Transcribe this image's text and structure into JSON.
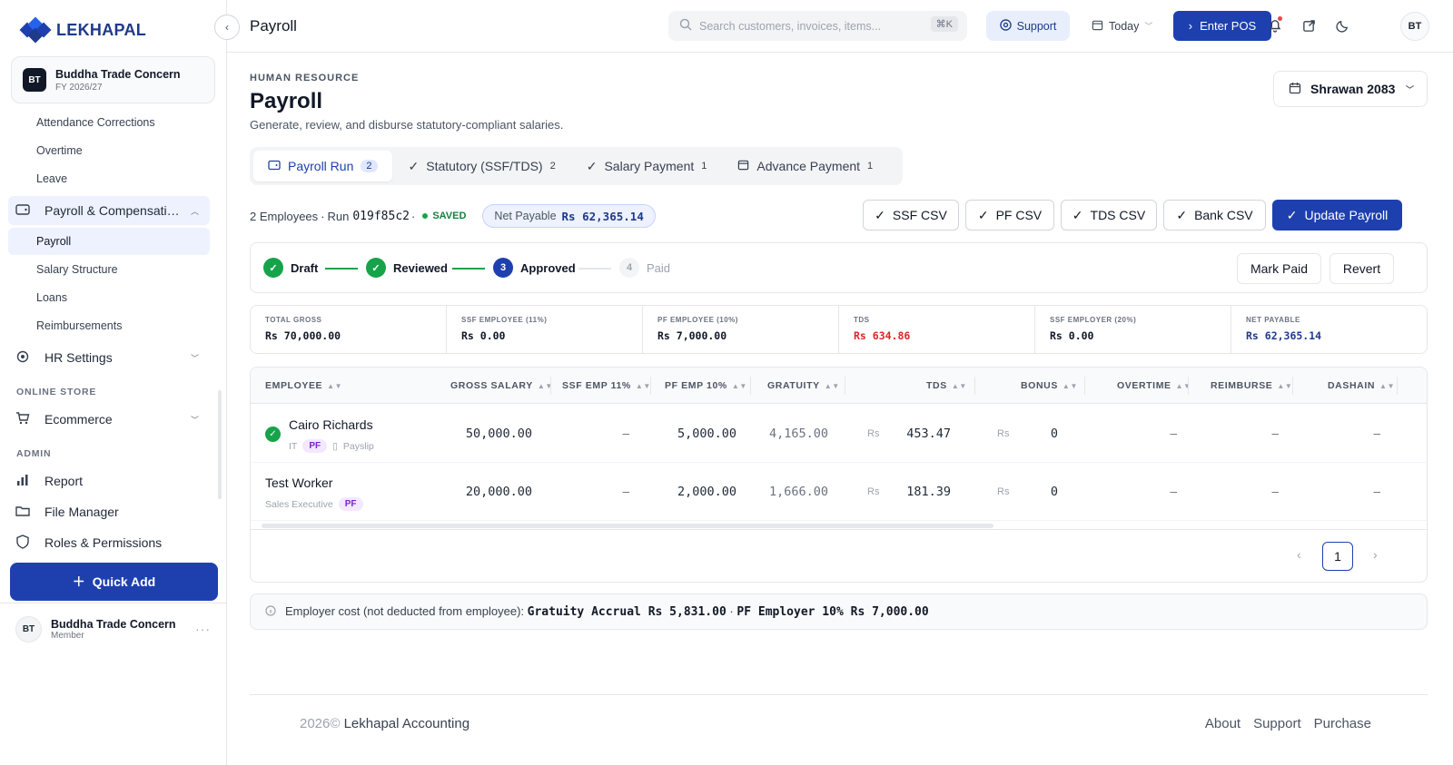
{
  "colors": {
    "primary": "#1e40af",
    "success": "#16a34a",
    "danger": "#dc2626",
    "pf_badge": "#7e22ce"
  },
  "brand": {
    "name": "LEKHAPAL"
  },
  "org": {
    "initials": "BT",
    "name": "Buddha Trade Concern",
    "fy": "FY 2026/27"
  },
  "sidebar": {
    "items": [
      {
        "label": "Attendance Corrections"
      },
      {
        "label": "Overtime"
      },
      {
        "label": "Leave"
      }
    ],
    "payroll_group": {
      "label": "Payroll & Compensati…",
      "icon": "wallet-icon"
    },
    "payroll_items": [
      {
        "label": "Payroll"
      },
      {
        "label": "Salary Structure"
      },
      {
        "label": "Loans"
      },
      {
        "label": "Reimbursements"
      }
    ],
    "hr_settings": {
      "label": "HR Settings",
      "icon": "settings-icon"
    },
    "online_store_section": "ONLINE STORE",
    "ecommerce": {
      "label": "Ecommerce",
      "icon": "cart-icon"
    },
    "admin_section": "ADMIN",
    "report": {
      "label": "Report",
      "icon": "report-icon"
    },
    "file_manager": {
      "label": "File Manager",
      "icon": "folder-icon"
    },
    "roles": {
      "label": "Roles & Permissions",
      "icon": "shield-icon"
    },
    "quick_add": "Quick Add",
    "user": {
      "initials": "BT",
      "name": "Buddha Trade Concern",
      "role": "Member"
    }
  },
  "topbar": {
    "title": "Payroll",
    "search_placeholder": "Search customers, invoices, items...",
    "search_shortcut": "⌘K",
    "support": "Support",
    "date": "Today",
    "pos": "Enter POS",
    "avatar": "BT"
  },
  "page": {
    "eyebrow": "HUMAN RESOURCE",
    "title": "Payroll",
    "description": "Generate, review, and disburse statutory-compliant salaries.",
    "period": "Shrawan 2083"
  },
  "tabs": [
    {
      "label": "Payroll Run",
      "count": "2"
    },
    {
      "label": "Statutory (SSF/TDS)",
      "count": "2"
    },
    {
      "label": "Salary Payment",
      "count": "1"
    },
    {
      "label": "Advance Payment",
      "count": "1"
    }
  ],
  "run": {
    "employees": "2 Employees",
    "sep": "·",
    "run_label": "Run",
    "run_id": "019f85c2",
    "status": "SAVED",
    "net_label": "Net Payable",
    "net_value": "Rs 62,365.14"
  },
  "actions": {
    "ssf": "SSF CSV",
    "pf": "PF CSV",
    "tds": "TDS CSV",
    "bank": "Bank CSV",
    "update": "Update Payroll"
  },
  "steps": [
    {
      "label": "Draft",
      "state": "done"
    },
    {
      "label": "Reviewed",
      "state": "done"
    },
    {
      "label": "Approved",
      "number": "3",
      "state": "current"
    },
    {
      "label": "Paid",
      "number": "4",
      "state": "pending"
    }
  ],
  "step_actions": {
    "mark_paid": "Mark Paid",
    "revert": "Revert"
  },
  "stats": [
    {
      "label": "TOTAL GROSS",
      "value": "Rs 70,000.00"
    },
    {
      "label": "SSF EMPLOYEE (11%)",
      "value": "Rs 0.00"
    },
    {
      "label": "PF EMPLOYEE (10%)",
      "value": "Rs 7,000.00"
    },
    {
      "label": "TDS",
      "value": "Rs 634.86"
    },
    {
      "label": "SSF EMPLOYER (20%)",
      "value": "Rs 0.00"
    },
    {
      "label": "NET PAYABLE",
      "value": "Rs 62,365.14"
    }
  ],
  "table": {
    "columns": [
      "EMPLOYEE",
      "GROSS SALARY",
      "SSF EMP 11%",
      "PF EMP 10%",
      "GRATUITY",
      "TDS",
      "BONUS",
      "OVERTIME",
      "REIMBURSE",
      "DASHAIN"
    ],
    "rows": [
      {
        "name": "Cairo Richards",
        "dept": "IT",
        "badge": "PF",
        "payslip": "Payslip",
        "gross": "50,000.00",
        "ssf": "–",
        "pf": "5,000.00",
        "gratuity": "4,165.00",
        "tds_cur": "Rs",
        "tds": "453.47",
        "bonus_cur": "Rs",
        "bonus": "0",
        "overtime": "–",
        "reimburse": "–",
        "dashain": "–"
      },
      {
        "name": "Test Worker",
        "dept": "Sales Executive",
        "badge": "PF",
        "gross": "20,000.00",
        "ssf": "–",
        "pf": "2,000.00",
        "gratuity": "1,666.00",
        "tds_cur": "Rs",
        "tds": "181.39",
        "bonus_cur": "Rs",
        "bonus": "0",
        "overtime": "–",
        "reimburse": "–",
        "dashain": "–"
      }
    ]
  },
  "pagination": {
    "current": "1"
  },
  "employer_note": {
    "label": "Employer cost (not deducted from employee):",
    "gratuity": "Gratuity Accrual Rs 5,831.00",
    "sep": "·",
    "pf": "PF Employer 10% Rs 7,000.00"
  },
  "footer": {
    "year": "2026©",
    "company": "Lekhapal Accounting",
    "links": [
      "About",
      "Support",
      "Purchase"
    ]
  }
}
